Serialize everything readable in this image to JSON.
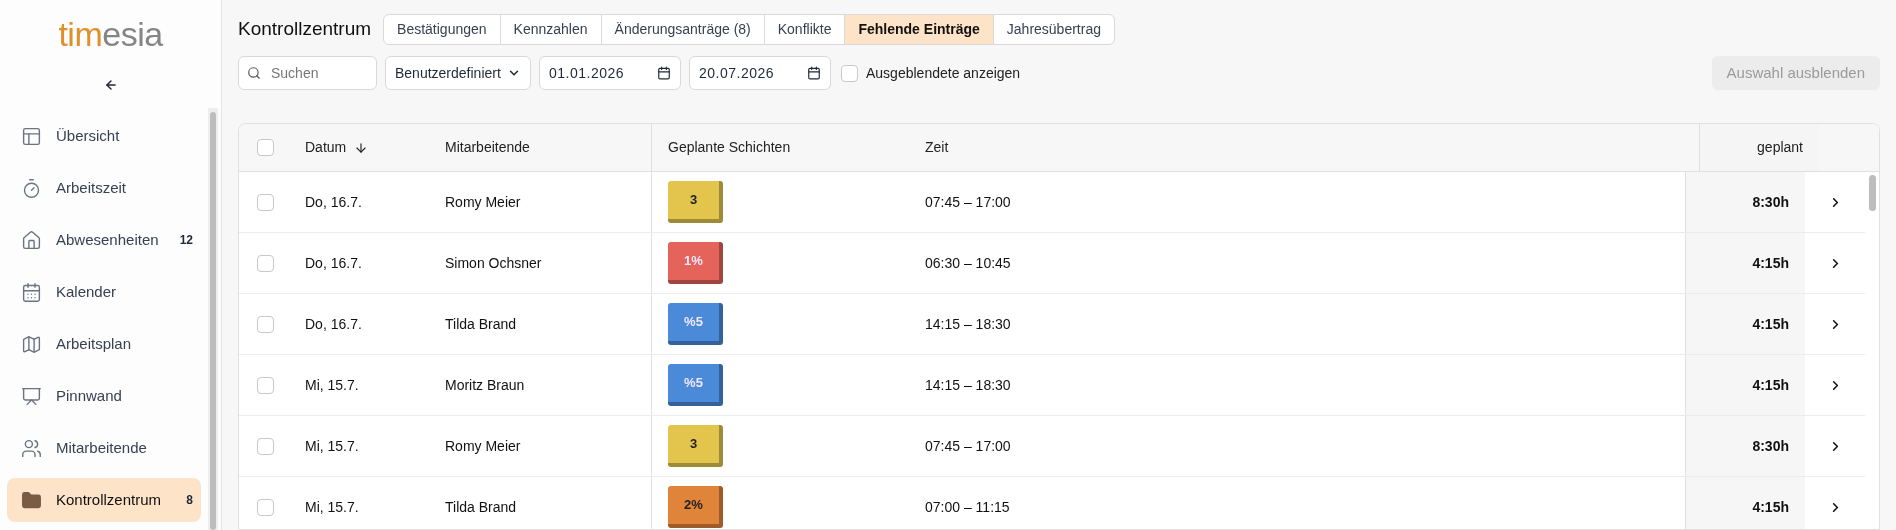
{
  "logo": {
    "primary": "tim",
    "secondary": "esia"
  },
  "sidebar": {
    "items": [
      {
        "label": "Übersicht",
        "selected": false
      },
      {
        "label": "Arbeitszeit",
        "selected": false
      },
      {
        "label": "Abwesenheiten",
        "selected": false,
        "badge": "12"
      },
      {
        "label": "Kalender",
        "selected": false
      },
      {
        "label": "Arbeitsplan",
        "selected": false
      },
      {
        "label": "Pinnwand",
        "selected": false
      },
      {
        "label": "Mitarbeitende",
        "selected": false
      },
      {
        "label": "Kontrollzentrum",
        "selected": true,
        "badge": "8"
      }
    ]
  },
  "page_title": "Kontrollzentrum",
  "tabs": [
    {
      "label": "Bestätigungen",
      "selected": false
    },
    {
      "label": "Kennzahlen",
      "selected": false
    },
    {
      "label": "Änderungsanträge (8)",
      "selected": false
    },
    {
      "label": "Konflikte",
      "selected": false
    },
    {
      "label": "Fehlende Einträge",
      "selected": true
    },
    {
      "label": "Jahresübertrag",
      "selected": false
    }
  ],
  "toolbar": {
    "search": {
      "placeholder": "Suchen"
    },
    "range": {
      "value": "Benutzerdefiniert"
    },
    "date_from": {
      "value": "01.01.2026"
    },
    "date_to": {
      "value": "20.07.2026"
    },
    "show_hidden": {
      "label": "Ausgeblendete anzeigen",
      "checked": false
    },
    "hide_button": {
      "label": "Auswahl ausblenden",
      "disabled": true
    }
  },
  "table": {
    "select_all": {
      "checked": false
    },
    "columns": [
      {
        "label": "Datum",
        "sorted": true
      },
      {
        "label": "Mitarbeitende"
      },
      {
        "label": "Geplante Schichten"
      },
      {
        "label": "Zeit"
      },
      {
        "label": "geplant"
      }
    ],
    "rows": [
      {
        "checked": false,
        "date": "Do, 16.7.",
        "employee": "Romy Meier",
        "shift": {
          "label": "3",
          "color": "#e3c54e"
        },
        "time": "07:45 – 17:00",
        "planned": "8:30h"
      },
      {
        "checked": false,
        "date": "Do, 16.7.",
        "employee": "Simon Ochsner",
        "shift": {
          "label": "1%",
          "color": "#e4645c"
        },
        "time": "06:30 – 10:45",
        "planned": "4:15h"
      },
      {
        "checked": false,
        "date": "Do, 16.7.",
        "employee": "Tilda Brand",
        "shift": {
          "label": "%5",
          "color": "#4a8ad8"
        },
        "time": "14:15 – 18:30",
        "planned": "4:15h"
      },
      {
        "checked": false,
        "date": "Mi, 15.7.",
        "employee": "Moritz Braun",
        "shift": {
          "label": "%5",
          "color": "#4a8ad8"
        },
        "time": "14:15 – 18:30",
        "planned": "4:15h"
      },
      {
        "checked": false,
        "date": "Mi, 15.7.",
        "employee": "Romy Meier",
        "shift": {
          "label": "3",
          "color": "#e3c54e"
        },
        "time": "07:45 – 17:00",
        "planned": "8:30h"
      },
      {
        "checked": false,
        "date": "Mi, 15.7.",
        "employee": "Tilda Brand",
        "shift": {
          "label": "2%",
          "color": "#e0843a"
        },
        "time": "07:00 – 11:15",
        "planned": "4:15h"
      }
    ]
  }
}
